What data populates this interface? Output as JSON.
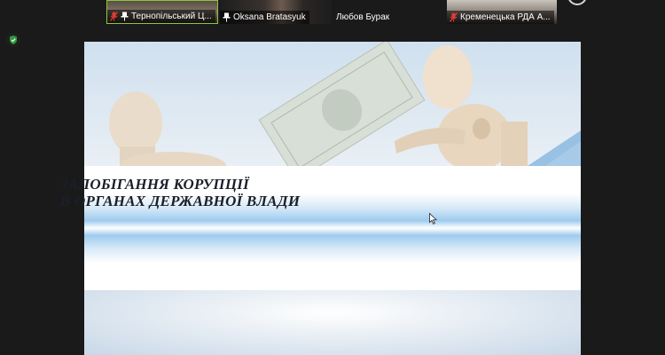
{
  "participants": [
    {
      "name": "Тернопільський Ц...",
      "muted": true,
      "pinned": true
    },
    {
      "name": "Oksana Bratasyuk",
      "muted": false,
      "pinned": true
    },
    {
      "name": "Любов Бурак",
      "muted": false,
      "pinned": false
    },
    {
      "name": "Кременецька РДА А...",
      "muted": true,
      "pinned": false
    }
  ],
  "slide": {
    "title_line1": "ЗАПОБІГАННЯ КОРУПЦІЇ",
    "title_line2": "В ОРГАНАХ ДЕРЖАВНОЇ ВЛАДИ"
  },
  "colors": {
    "active_speaker_border": "#8cc63f",
    "muted_icon": "#e53935",
    "security_badge": "#2e9d3a",
    "meeting_background": "#1a1a1a"
  }
}
